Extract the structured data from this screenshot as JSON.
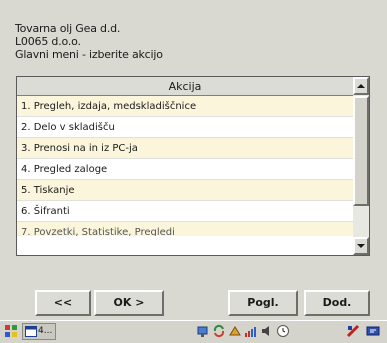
{
  "header": {
    "line1": "Tovarna olj Gea d.d.",
    "line2": "L0065 d.o.o.",
    "line3": "Glavni meni - izberite akcijo"
  },
  "list": {
    "column_header": "Akcija",
    "items": [
      "1. Pregleh, izdaja, medskladiščnice",
      "2. Delo v skladišču",
      "3. Prenosi na in iz PC-ja",
      "4. Pregled zaloge",
      "5. Tiskanje",
      "6. Šifranti",
      "7. Povzetki, Statistike, Pregledi"
    ]
  },
  "buttons": {
    "back": "<<",
    "ok": "OK >",
    "view": "Pogl.",
    "add": "Dod."
  },
  "taskbar": {
    "app_label": "4..."
  },
  "colors": {
    "row_alt": "#fbf5dc",
    "background": "#d9d9d2"
  }
}
